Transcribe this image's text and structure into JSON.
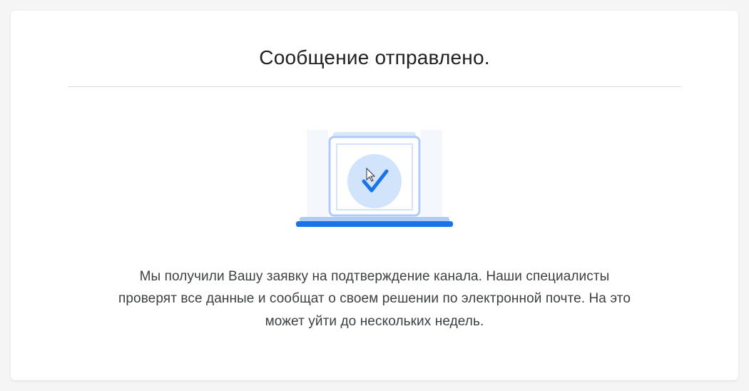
{
  "message": {
    "title": "Сообщение отправлено.",
    "description": "Мы получили Вашу заявку на подтверждение канала. Наши специалисты проверят все данные и сообщат о своем решении по электронной почте. На это может уйти до нескольких недель."
  }
}
